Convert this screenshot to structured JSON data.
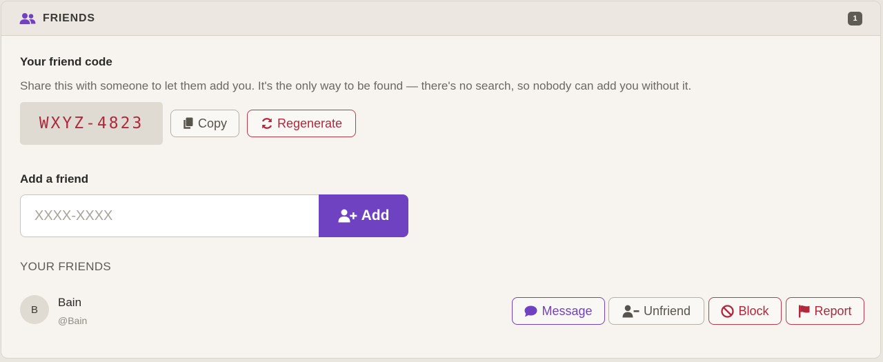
{
  "header": {
    "icon": "users-icon",
    "title": "FRIENDS",
    "badge": "1"
  },
  "friend_code": {
    "label": "Your friend code",
    "description": "Share this with someone to let them add you. It's the only way to be found — there's no search, so nobody can add you without it.",
    "code": "WXYZ-4823",
    "copy_label": "Copy",
    "regenerate_label": "Regenerate"
  },
  "add_friend": {
    "label": "Add a friend",
    "placeholder": "XXXX-XXXX",
    "value": "",
    "add_label": "Add"
  },
  "friends": {
    "section_title": "YOUR FRIENDS",
    "items": [
      {
        "avatar_initial": "B",
        "name": "Bain",
        "handle": "@Bain",
        "actions": {
          "message": "Message",
          "unfriend": "Unfriend",
          "block": "Block",
          "report": "Report"
        }
      }
    ]
  },
  "colors": {
    "accent": "#6f42c1",
    "danger": "#b0283c",
    "background": "#f7f4ef"
  }
}
